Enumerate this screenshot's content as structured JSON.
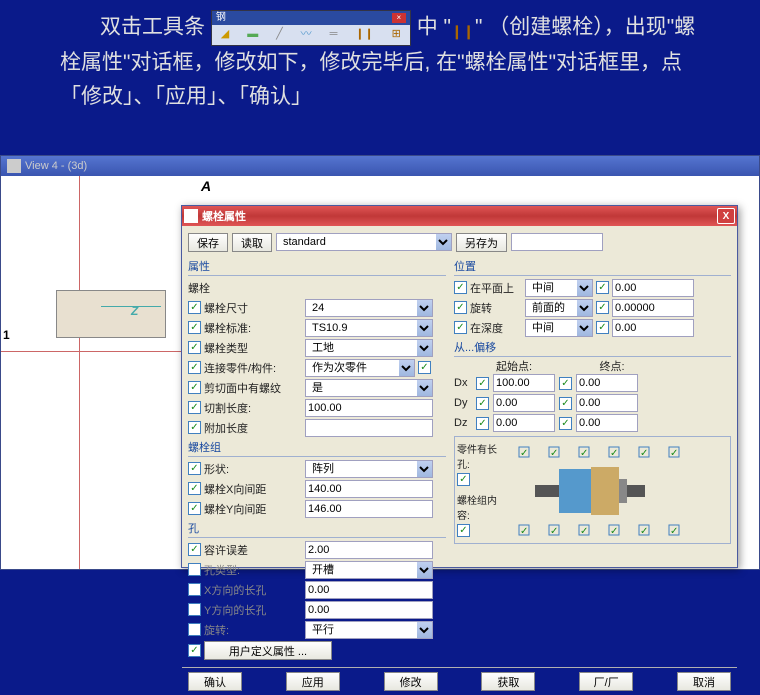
{
  "instruction": {
    "part1": "双击工具条",
    "toolbar_title": "钢",
    "part2": "中 \"",
    "part3": "\" （创建螺栓），出现\"螺栓属性\"对话框，修改如下，修改完毕后, 在\"螺栓属性\"对话框里，点「修改」、「应用」、「确认」"
  },
  "view_window": {
    "title": "View 4 - (3d)",
    "letter_a": "A",
    "letter_z": "Z",
    "num_1": "1"
  },
  "dialog": {
    "title": "螺栓属性",
    "top_bar": {
      "save": "保存",
      "load": "读取",
      "preset": "standard",
      "save_as": "另存为",
      "save_as_val": ""
    },
    "left": {
      "group_attr": "属性",
      "bolt": "螺栓",
      "size_label": "螺栓尺寸",
      "size_val": "24",
      "std_label": "螺栓标准:",
      "std_val": "TS10.9",
      "type_label": "螺栓类型",
      "type_val": "工地",
      "connect_label": "连接零件/构件:",
      "connect_val": "作为次零件",
      "thread_label": "剪切面中有螺纹",
      "thread_val": "是",
      "cut_label": "切割长度:",
      "cut_val": "100.00",
      "extra_label": "附加长度",
      "extra_val": "",
      "group_arr": "螺栓组",
      "shape_label": "形状:",
      "shape_val": "阵列",
      "xspace_label": "螺栓X向间距",
      "xspace_val": "140.00",
      "yspace_label": "螺栓Y向间距",
      "yspace_val": "146.00",
      "group_hole": "孔",
      "tol_label": "容许误差",
      "tol_val": "2.00",
      "htype_label": "孔类型:",
      "htype_val": "开槽",
      "xslot_label": "X方向的长孔",
      "xslot_val": "0.00",
      "yslot_label": "Y方向的长孔",
      "yslot_val": "0.00",
      "rot_label": "旋转:",
      "rot_val": "平行",
      "custom": "用户定义属性 ..."
    },
    "right": {
      "group_pos": "位置",
      "plane_label": "在平面上",
      "plane_sel": "中间",
      "plane_val": "0.00",
      "rotate_label": "旋转",
      "rotate_sel": "前面的",
      "rotate_val": "0.00000",
      "depth_label": "在深度",
      "depth_sel": "中间",
      "depth_val": "0.00",
      "group_offset": "从...偏移",
      "hdr_start": "起始点:",
      "hdr_end": "终点:",
      "dx": "Dx",
      "dx_start": "100.00",
      "dx_end": "0.00",
      "dy": "Dy",
      "dy_start": "0.00",
      "dy_end": "0.00",
      "dz": "Dz",
      "dz_start": "0.00",
      "dz_end": "0.00",
      "diag_parts": "零件有长孔:",
      "diag_content": "螺栓组内容:"
    },
    "buttons": {
      "ok": "确认",
      "apply": "应用",
      "modify": "修改",
      "get": "获取",
      "toggle": "厂/厂",
      "cancel": "取消"
    }
  }
}
